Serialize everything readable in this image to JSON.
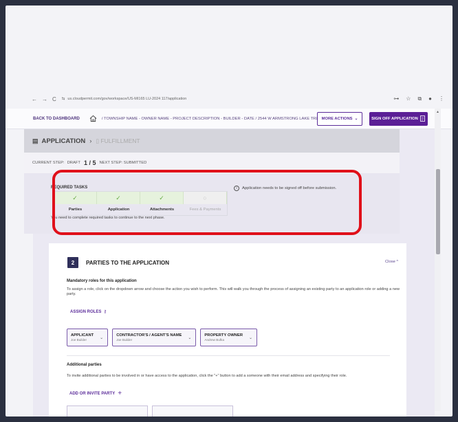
{
  "browser": {
    "url": "us.cloudpermit.com/gov/workspace/US-MI165 LU-2024 117/application",
    "nav_back": "←",
    "nav_forward": "→",
    "nav_reload": "C",
    "site_info": "⇆"
  },
  "header": {
    "back_label": "BACK TO DASHBOARD",
    "breadcrumb": "/ TOWNSHIP NAME - OWNER NAME - PROJECT DESCRIPTION - BUILDER - DATE / 2544 W ARMSTRONG LAKE TRL",
    "more_actions_label": "MORE ACTIONS",
    "sign_off_label": "SIGN OFF APPLICATION"
  },
  "phases": {
    "current": "APPLICATION",
    "next": "FULFILLMENT"
  },
  "step": {
    "current_label": "CURRENT STEP:",
    "current_value": "DRAFT",
    "count": "1 / 5",
    "next_label": "NEXT STEP: SUBMITTED"
  },
  "required_tasks": {
    "title": "REQUIRED TASKS",
    "tasks": [
      {
        "label": "Parties",
        "status": "done"
      },
      {
        "label": "Application",
        "status": "done"
      },
      {
        "label": "Attachments",
        "status": "done"
      },
      {
        "label": "Fees & Payments",
        "status": "pending"
      }
    ],
    "note": "You need to complete required tasks to continue to the next phase.",
    "info_message": "Application needs to be signed off before submission.",
    "highlight_color": "#e0101a"
  },
  "parties_section": {
    "number": "2",
    "title": "PARTIES TO THE APPLICATION",
    "close_label": "Close ^",
    "mandatory_title": "Mandatory roles for this application",
    "mandatory_desc": "To assign a role, click on the dropdown arrow and choose the action you wish to perform. This will walk you through the process of assigning an existing party to an application role or adding a new party.",
    "assign_roles_label": "ASSIGN ROLES",
    "roles": [
      {
        "name": "APPLICANT",
        "person": "Joe Builder"
      },
      {
        "name": "CONTRACTOR'S / AGENT'S NAME",
        "person": "Joe Builder"
      },
      {
        "name": "PROPERTY OWNER",
        "person": "Andrew Bufka"
      }
    ],
    "additional_title": "Additional parties",
    "additional_desc": "To invite additional parties to be involved in or have access to the application, click the \"+\" button to add a someone with their email address and specifying their role.",
    "add_party_label": "ADD OR INVITE PARTY",
    "add_party_icon": "+"
  },
  "colors": {
    "brand_purple": "#5b1f96",
    "check_green": "#66aa44",
    "section_badge": "#2f2f5a"
  }
}
